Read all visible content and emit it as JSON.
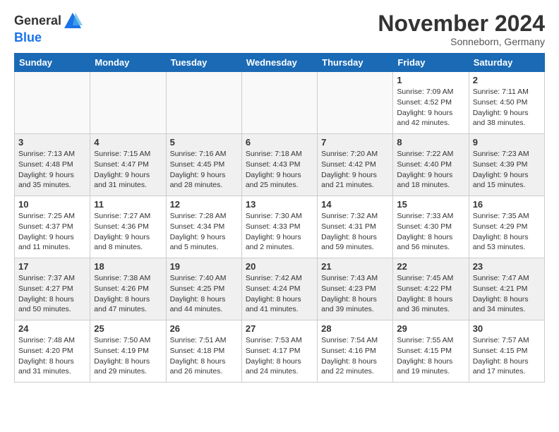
{
  "header": {
    "logo_general": "General",
    "logo_blue": "Blue",
    "month_title": "November 2024",
    "location": "Sonneborn, Germany"
  },
  "days_of_week": [
    "Sunday",
    "Monday",
    "Tuesday",
    "Wednesday",
    "Thursday",
    "Friday",
    "Saturday"
  ],
  "weeks": [
    {
      "shaded": false,
      "days": [
        {
          "num": "",
          "info": ""
        },
        {
          "num": "",
          "info": ""
        },
        {
          "num": "",
          "info": ""
        },
        {
          "num": "",
          "info": ""
        },
        {
          "num": "",
          "info": ""
        },
        {
          "num": "1",
          "info": "Sunrise: 7:09 AM\nSunset: 4:52 PM\nDaylight: 9 hours\nand 42 minutes."
        },
        {
          "num": "2",
          "info": "Sunrise: 7:11 AM\nSunset: 4:50 PM\nDaylight: 9 hours\nand 38 minutes."
        }
      ]
    },
    {
      "shaded": true,
      "days": [
        {
          "num": "3",
          "info": "Sunrise: 7:13 AM\nSunset: 4:48 PM\nDaylight: 9 hours\nand 35 minutes."
        },
        {
          "num": "4",
          "info": "Sunrise: 7:15 AM\nSunset: 4:47 PM\nDaylight: 9 hours\nand 31 minutes."
        },
        {
          "num": "5",
          "info": "Sunrise: 7:16 AM\nSunset: 4:45 PM\nDaylight: 9 hours\nand 28 minutes."
        },
        {
          "num": "6",
          "info": "Sunrise: 7:18 AM\nSunset: 4:43 PM\nDaylight: 9 hours\nand 25 minutes."
        },
        {
          "num": "7",
          "info": "Sunrise: 7:20 AM\nSunset: 4:42 PM\nDaylight: 9 hours\nand 21 minutes."
        },
        {
          "num": "8",
          "info": "Sunrise: 7:22 AM\nSunset: 4:40 PM\nDaylight: 9 hours\nand 18 minutes."
        },
        {
          "num": "9",
          "info": "Sunrise: 7:23 AM\nSunset: 4:39 PM\nDaylight: 9 hours\nand 15 minutes."
        }
      ]
    },
    {
      "shaded": false,
      "days": [
        {
          "num": "10",
          "info": "Sunrise: 7:25 AM\nSunset: 4:37 PM\nDaylight: 9 hours\nand 11 minutes."
        },
        {
          "num": "11",
          "info": "Sunrise: 7:27 AM\nSunset: 4:36 PM\nDaylight: 9 hours\nand 8 minutes."
        },
        {
          "num": "12",
          "info": "Sunrise: 7:28 AM\nSunset: 4:34 PM\nDaylight: 9 hours\nand 5 minutes."
        },
        {
          "num": "13",
          "info": "Sunrise: 7:30 AM\nSunset: 4:33 PM\nDaylight: 9 hours\nand 2 minutes."
        },
        {
          "num": "14",
          "info": "Sunrise: 7:32 AM\nSunset: 4:31 PM\nDaylight: 8 hours\nand 59 minutes."
        },
        {
          "num": "15",
          "info": "Sunrise: 7:33 AM\nSunset: 4:30 PM\nDaylight: 8 hours\nand 56 minutes."
        },
        {
          "num": "16",
          "info": "Sunrise: 7:35 AM\nSunset: 4:29 PM\nDaylight: 8 hours\nand 53 minutes."
        }
      ]
    },
    {
      "shaded": true,
      "days": [
        {
          "num": "17",
          "info": "Sunrise: 7:37 AM\nSunset: 4:27 PM\nDaylight: 8 hours\nand 50 minutes."
        },
        {
          "num": "18",
          "info": "Sunrise: 7:38 AM\nSunset: 4:26 PM\nDaylight: 8 hours\nand 47 minutes."
        },
        {
          "num": "19",
          "info": "Sunrise: 7:40 AM\nSunset: 4:25 PM\nDaylight: 8 hours\nand 44 minutes."
        },
        {
          "num": "20",
          "info": "Sunrise: 7:42 AM\nSunset: 4:24 PM\nDaylight: 8 hours\nand 41 minutes."
        },
        {
          "num": "21",
          "info": "Sunrise: 7:43 AM\nSunset: 4:23 PM\nDaylight: 8 hours\nand 39 minutes."
        },
        {
          "num": "22",
          "info": "Sunrise: 7:45 AM\nSunset: 4:22 PM\nDaylight: 8 hours\nand 36 minutes."
        },
        {
          "num": "23",
          "info": "Sunrise: 7:47 AM\nSunset: 4:21 PM\nDaylight: 8 hours\nand 34 minutes."
        }
      ]
    },
    {
      "shaded": false,
      "days": [
        {
          "num": "24",
          "info": "Sunrise: 7:48 AM\nSunset: 4:20 PM\nDaylight: 8 hours\nand 31 minutes."
        },
        {
          "num": "25",
          "info": "Sunrise: 7:50 AM\nSunset: 4:19 PM\nDaylight: 8 hours\nand 29 minutes."
        },
        {
          "num": "26",
          "info": "Sunrise: 7:51 AM\nSunset: 4:18 PM\nDaylight: 8 hours\nand 26 minutes."
        },
        {
          "num": "27",
          "info": "Sunrise: 7:53 AM\nSunset: 4:17 PM\nDaylight: 8 hours\nand 24 minutes."
        },
        {
          "num": "28",
          "info": "Sunrise: 7:54 AM\nSunset: 4:16 PM\nDaylight: 8 hours\nand 22 minutes."
        },
        {
          "num": "29",
          "info": "Sunrise: 7:55 AM\nSunset: 4:15 PM\nDaylight: 8 hours\nand 19 minutes."
        },
        {
          "num": "30",
          "info": "Sunrise: 7:57 AM\nSunset: 4:15 PM\nDaylight: 8 hours\nand 17 minutes."
        }
      ]
    }
  ]
}
